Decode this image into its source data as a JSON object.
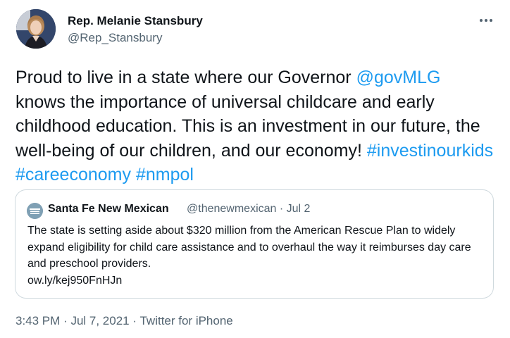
{
  "tweet": {
    "author": {
      "name": "Rep. Melanie Stansbury",
      "handle": "@Rep_Stansbury"
    },
    "more_icon": "more-horizontal-icon",
    "body": {
      "part1": "Proud to live in a state where our Governor ",
      "mention": "@govMLG",
      "part2": " knows the importance of universal childcare and early childhood education. This is an investment in our future, the well-being of our children, and our economy! ",
      "hashtags": [
        "#investinourkids",
        "#careeconomy",
        "#nmpol"
      ]
    },
    "quoted": {
      "name": "Santa Fe New Mexican",
      "handle": "@thenewmexican",
      "separator": "·",
      "date": "Jul 2",
      "text": "The state is setting aside about $320 million from the American Rescue Plan to widely expand eligibility for child care assistance and to overhaul the way it reimburses day care and preschool providers.",
      "url": "ow.ly/kej950FnHJn",
      "avatar_text": "SANTA FE NEW MEXICAN"
    },
    "footer": {
      "time": "3:43 PM",
      "separator": "·",
      "date": "Jul 7, 2021",
      "source": "Twitter for iPhone"
    }
  },
  "colors": {
    "link": "#1d9bf0",
    "text": "#0f1419",
    "secondary": "#536471",
    "border": "#cfd9de"
  }
}
